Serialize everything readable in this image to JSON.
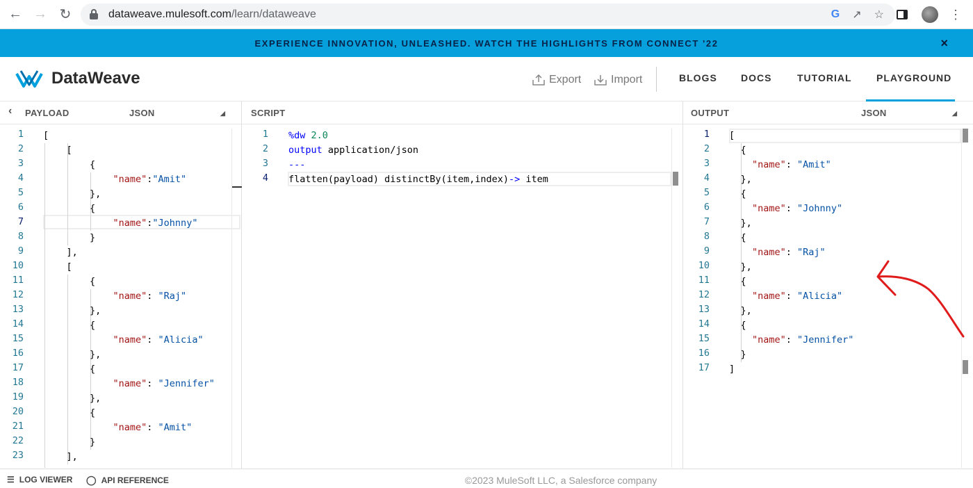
{
  "browser": {
    "url_host": "dataweave.mulesoft.com",
    "url_path": "/learn/dataweave"
  },
  "banner": {
    "text": "EXPERIENCE INNOVATION, UNLEASHED. WATCH THE HIGHLIGHTS FROM CONNECT '22",
    "close": "×",
    "color": "#06a0dc"
  },
  "app": {
    "name": "DataWeave",
    "export_label": "Export",
    "import_label": "Import",
    "nav": [
      "BLOGS",
      "DOCS",
      "TUTORIAL",
      "PLAYGROUND"
    ],
    "active_nav": "PLAYGROUND"
  },
  "payload_panel": {
    "title": "PAYLOAD",
    "format": "JSON",
    "lines": [
      {
        "n": "1",
        "indent": 0,
        "text": "["
      },
      {
        "n": "2",
        "indent": 1,
        "text": "["
      },
      {
        "n": "3",
        "indent": 2,
        "text": "{"
      },
      {
        "n": "4",
        "indent": 3,
        "key": "\"name\"",
        "sep": ":",
        "val": "\"Amit\""
      },
      {
        "n": "5",
        "indent": 2,
        "text": "},"
      },
      {
        "n": "6",
        "indent": 2,
        "text": "{"
      },
      {
        "n": "7",
        "indent": 3,
        "key": "\"name\"",
        "sep": ":",
        "val": "\"Johnny\""
      },
      {
        "n": "8",
        "indent": 2,
        "text": "}"
      },
      {
        "n": "9",
        "indent": 1,
        "text": "],"
      },
      {
        "n": "10",
        "indent": 1,
        "text": "["
      },
      {
        "n": "11",
        "indent": 2,
        "text": "{"
      },
      {
        "n": "12",
        "indent": 3,
        "key": "\"name\"",
        "sep": ": ",
        "val": "\"Raj\""
      },
      {
        "n": "13",
        "indent": 2,
        "text": "},"
      },
      {
        "n": "14",
        "indent": 2,
        "text": "{"
      },
      {
        "n": "15",
        "indent": 3,
        "key": "\"name\"",
        "sep": ": ",
        "val": "\"Alicia\""
      },
      {
        "n": "16",
        "indent": 2,
        "text": "},"
      },
      {
        "n": "17",
        "indent": 2,
        "text": "{"
      },
      {
        "n": "18",
        "indent": 3,
        "key": "\"name\"",
        "sep": ": ",
        "val": "\"Jennifer\""
      },
      {
        "n": "19",
        "indent": 2,
        "text": "},"
      },
      {
        "n": "20",
        "indent": 2,
        "text": "{"
      },
      {
        "n": "21",
        "indent": 3,
        "key": "\"name\"",
        "sep": ": ",
        "val": "\"Amit\""
      },
      {
        "n": "22",
        "indent": 2,
        "text": "}"
      },
      {
        "n": "23",
        "indent": 1,
        "text": "],"
      }
    ]
  },
  "script_panel": {
    "title": "SCRIPT",
    "lines": [
      {
        "n": "1",
        "tokens": [
          {
            "t": "%dw ",
            "c": "kw"
          },
          {
            "t": "2.0",
            "c": "num"
          }
        ]
      },
      {
        "n": "2",
        "tokens": [
          {
            "t": "output",
            "c": "kw"
          },
          {
            "t": " application/json",
            "c": "plain"
          }
        ]
      },
      {
        "n": "3",
        "tokens": [
          {
            "t": "---",
            "c": "kw"
          }
        ]
      },
      {
        "n": "4",
        "tokens": [
          {
            "t": "flatten(payload) distinctBy(item,index)",
            "c": "plain"
          },
          {
            "t": "->",
            "c": "kw"
          },
          {
            "t": " item",
            "c": "plain"
          }
        ]
      }
    ]
  },
  "output_panel": {
    "title": "OUTPUT",
    "format": "JSON",
    "lines": [
      {
        "n": "1",
        "indent": 0,
        "text": "["
      },
      {
        "n": "2",
        "indent": 1,
        "text": "{"
      },
      {
        "n": "3",
        "indent": 2,
        "key": "\"name\"",
        "sep": ": ",
        "val": "\"Amit\""
      },
      {
        "n": "4",
        "indent": 1,
        "text": "},"
      },
      {
        "n": "5",
        "indent": 1,
        "text": "{"
      },
      {
        "n": "6",
        "indent": 2,
        "key": "\"name\"",
        "sep": ": ",
        "val": "\"Johnny\""
      },
      {
        "n": "7",
        "indent": 1,
        "text": "},"
      },
      {
        "n": "8",
        "indent": 1,
        "text": "{"
      },
      {
        "n": "9",
        "indent": 2,
        "key": "\"name\"",
        "sep": ": ",
        "val": "\"Raj\""
      },
      {
        "n": "10",
        "indent": 1,
        "text": "},"
      },
      {
        "n": "11",
        "indent": 1,
        "text": "{"
      },
      {
        "n": "12",
        "indent": 2,
        "key": "\"name\"",
        "sep": ": ",
        "val": "\"Alicia\""
      },
      {
        "n": "13",
        "indent": 1,
        "text": "},"
      },
      {
        "n": "14",
        "indent": 1,
        "text": "{"
      },
      {
        "n": "15",
        "indent": 2,
        "key": "\"name\"",
        "sep": ": ",
        "val": "\"Jennifer\""
      },
      {
        "n": "16",
        "indent": 1,
        "text": "}"
      },
      {
        "n": "17",
        "indent": 0,
        "text": "]"
      }
    ]
  },
  "footer": {
    "log_viewer": "LOG VIEWER",
    "api_reference": "API REFERENCE",
    "copyright": "©2023 MuleSoft LLC, a Salesforce company"
  }
}
